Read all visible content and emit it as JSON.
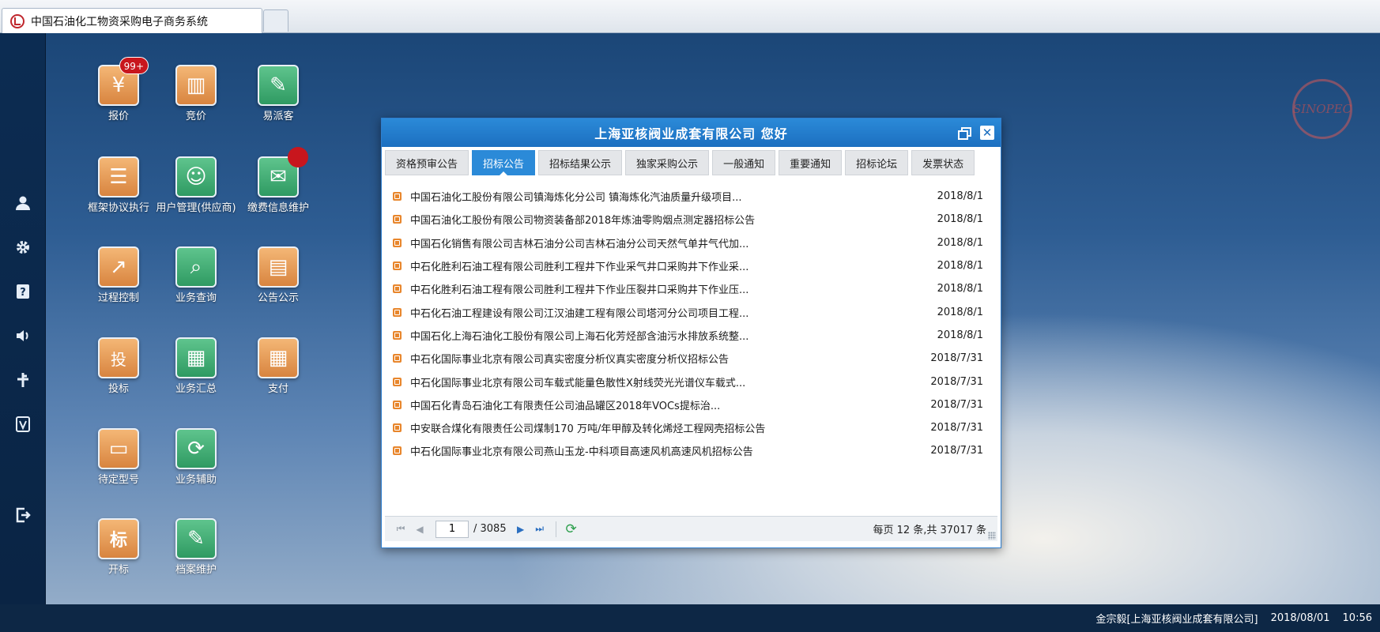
{
  "browser": {
    "tab_title": "中国石油化工物资采购电子商务系统"
  },
  "sidebar": {
    "items": [
      {
        "icon": "user-icon"
      },
      {
        "icon": "gear-icon"
      },
      {
        "icon": "help-icon"
      },
      {
        "icon": "speaker-icon"
      },
      {
        "icon": "pin-icon"
      },
      {
        "icon": "version-icon"
      },
      {
        "icon": "logout-icon"
      }
    ]
  },
  "logo": {
    "text": "SINOPEC"
  },
  "apps": [
    {
      "label": "报价",
      "badge": "99+",
      "icon": "quote-icon",
      "glyph": "¥"
    },
    {
      "label": "竞价",
      "icon": "bidding-icon",
      "glyph": "▥"
    },
    {
      "label": "易派客",
      "icon": "epaike-icon",
      "glyph": "✎"
    },
    {
      "label": "框架协议执行",
      "icon": "framework-agreement-icon",
      "glyph": "☰"
    },
    {
      "label": "用户管理(供应商)",
      "icon": "user-management-icon",
      "glyph": "☺"
    },
    {
      "label": "缴费信息维护",
      "icon": "payment-info-icon",
      "glyph": "✉"
    },
    {
      "label": "过程控制",
      "icon": "process-control-icon",
      "glyph": "↗"
    },
    {
      "label": "业务查询",
      "icon": "business-query-icon",
      "glyph": "⌕"
    },
    {
      "label": "公告公示",
      "icon": "announcement-icon",
      "glyph": "▤"
    },
    {
      "label": "投标",
      "icon": "tender-icon",
      "glyph": "投"
    },
    {
      "label": "业务汇总",
      "icon": "business-summary-icon",
      "glyph": "▦"
    },
    {
      "label": "支付",
      "icon": "payment-icon",
      "glyph": "▦"
    },
    {
      "label": "待定型号",
      "icon": "pending-model-icon",
      "glyph": "▭"
    },
    {
      "label": "业务辅助",
      "icon": "business-assist-icon",
      "glyph": "⟳"
    },
    {
      "label": "开标",
      "icon": "bid-opening-icon",
      "glyph": "标"
    },
    {
      "label": "档案维护",
      "icon": "archive-icon",
      "glyph": "✎"
    }
  ],
  "window": {
    "title": "上海亚核阀业成套有限公司 您好",
    "tabs": [
      "资格预审公告",
      "招标公告",
      "招标结果公示",
      "独家采购公示",
      "一般通知",
      "重要通知",
      "招标论坛",
      "发票状态"
    ],
    "active_tab": 1,
    "rows": [
      {
        "title": "中国石油化工股份有限公司镇海炼化分公司 镇海炼化汽油质量升级项目...",
        "date": "2018/8/1"
      },
      {
        "title": "中国石油化工股份有限公司物资装备部2018年炼油零购烟点测定器招标公告",
        "date": "2018/8/1"
      },
      {
        "title": "中国石化销售有限公司吉林石油分公司吉林石油分公司天然气单井气代加...",
        "date": "2018/8/1"
      },
      {
        "title": "中石化胜利石油工程有限公司胜利工程井下作业采气井口采购井下作业采...",
        "date": "2018/8/1"
      },
      {
        "title": "中石化胜利石油工程有限公司胜利工程井下作业压裂井口采购井下作业压...",
        "date": "2018/8/1"
      },
      {
        "title": "中石化石油工程建设有限公司江汉油建工程有限公司塔河分公司项目工程...",
        "date": "2018/8/1"
      },
      {
        "title": "中国石化上海石油化工股份有限公司上海石化芳烃部含油污水排放系统整...",
        "date": "2018/8/1"
      },
      {
        "title": "中石化国际事业北京有限公司真实密度分析仪真实密度分析仪招标公告",
        "date": "2018/7/31"
      },
      {
        "title": "中石化国际事业北京有限公司车载式能量色散性X射线荧光光谱仪车载式...",
        "date": "2018/7/31"
      },
      {
        "title": "中国石化青岛石油化工有限责任公司油品罐区2018年VOCs提标治...",
        "date": "2018/7/31"
      },
      {
        "title": "中安联合煤化有限责任公司煤制170 万吨/年甲醇及转化烯烃工程网壳招标公告",
        "date": "2018/7/31"
      },
      {
        "title": "中石化国际事业北京有限公司燕山玉龙-中科项目高速风机高速风机招标公告",
        "date": "2018/7/31"
      }
    ],
    "pager": {
      "current_page": "1",
      "total_pages": "/ 3085",
      "summary": "每页 12 条,共 37017 条"
    }
  },
  "status": {
    "user": "金宗毅[上海亚核阀业成套有限公司]",
    "date": "2018/08/01",
    "time": "10:56"
  }
}
